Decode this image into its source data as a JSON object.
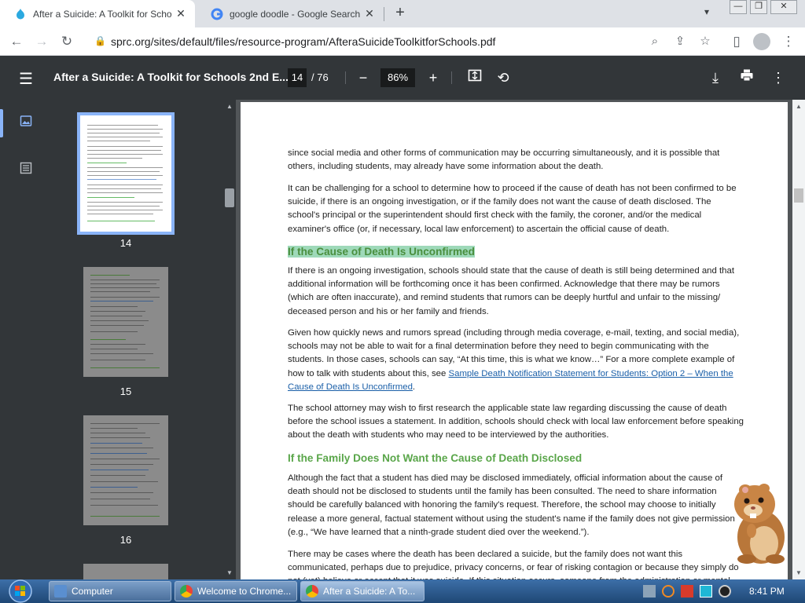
{
  "browser": {
    "tabs": [
      {
        "title": "After a Suicide: A Toolkit for Scho",
        "active": true
      },
      {
        "title": "google doodle - Google Search",
        "active": false
      }
    ],
    "new_tab_label": "+",
    "tab_close_label": "✕",
    "window_controls": [
      "—",
      "❐",
      "✕"
    ],
    "url": "sprc.org/sites/default/files/resource-program/AfteraSuicideToolkitforSchools.pdf"
  },
  "pdf": {
    "title": "After a Suicide: A Toolkit for Schools 2nd E...",
    "current_page": "14",
    "total_pages": "/ 76",
    "zoom": "86%",
    "thumbnails": [
      {
        "number": "14",
        "selected": true
      },
      {
        "number": "15",
        "selected": false
      },
      {
        "number": "16",
        "selected": false
      }
    ]
  },
  "page": {
    "p1": "since social media and other forms of communication may be occurring simultaneously, and it is possible that others, including students, may already have some information about the death.",
    "p2": "It can be challenging for a school to determine how to proceed if the cause of death has not been confirmed to be suicide, if there is an ongoing investigation, or if the family does not want the cause of death disclosed. The school's principal or the superintendent should first check with the family, the coroner, and/or the medical examiner's office (or, if necessary, local law enforcement) to ascertain the official cause of death.",
    "h1": "If the Cause of Death Is Unconfirmed",
    "p3": "If there is an ongoing investigation, schools should state that the cause of death is still being determined and that additional information will be forthcoming once it has been confirmed. Acknowledge that there may be rumors (which are often inaccurate), and remind students that rumors can be deeply hurtful and unfair to the missing/ deceased person and his or her family and friends.",
    "p4_start": "Given how quickly news and rumors spread (including through media coverage, e-mail, texting, and social media), schools may not be able to wait for a final determination before they need to begin communicating with the students. In those cases, schools can say, “At this time, this is what we know…” For a more complete example of how to talk with students about this, see ",
    "p4_link": "Sample Death Notification Statement for Students: Option 2 – When the Cause of Death Is Unconfirmed",
    "p4_end": ".",
    "p5": "The school attorney may wish to first research the applicable state law regarding discussing the cause of death before the school issues a statement. In addition, schools should check with local law enforcement before speaking about the death with students who may need to be interviewed by the authorities.",
    "h2": "If the Family Does Not Want the Cause of Death Disclosed",
    "p6": "Although the fact that a student has died may be disclosed immediately, official information about the cause of death should not be disclosed to students until the family has been consulted. The need to share information should be carefully balanced with honoring the family's request. Therefore, the school may choose to initially release a more general, factual statement without using the student's name if the family does not give permission (e.g., “We have learned that a ninth-grade student died over the weekend.”).",
    "p7": "There may be cases where the death has been declared a suicide, but the family does not want this communicated, perhaps due to prejudice, privacy concerns, or fear of risking contagion or because they simply do not (yet) believe or accept that it was suicide. If this situation occurs, someone from the administration or mental health staff who has a"
  },
  "taskbar": {
    "items": [
      {
        "label": "Computer",
        "active": false
      },
      {
        "label": "Welcome to Chrome...",
        "active": false
      },
      {
        "label": "After a Suicide: A To...",
        "active": true
      }
    ],
    "clock": "8:41 PM"
  },
  "colors": {
    "chrome_frame": "#dee1e6",
    "pdf_toolbar": "#323639",
    "heading_green": "#5aa64a",
    "highlight": "#9ed9b9",
    "link": "#1a5fa8"
  }
}
